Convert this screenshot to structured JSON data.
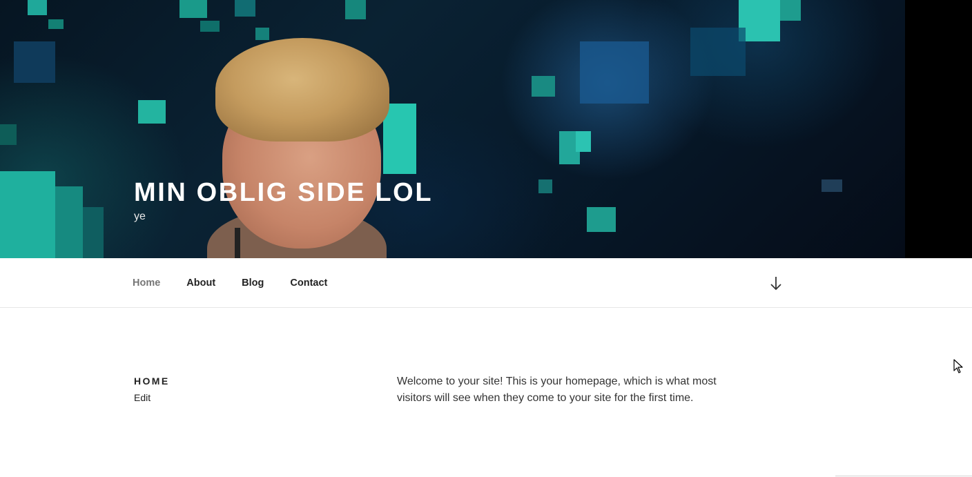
{
  "header": {
    "site_title": "MIN OBLIG SIDE LOL",
    "site_description": "ye",
    "colors": {
      "title": "#ffffff",
      "overlay": "#0a2233"
    }
  },
  "nav": {
    "items": [
      {
        "label": "Home",
        "current": true
      },
      {
        "label": "About",
        "current": false
      },
      {
        "label": "Blog",
        "current": false
      },
      {
        "label": "Contact",
        "current": false
      }
    ],
    "scroll_icon": "arrow-down-icon"
  },
  "page": {
    "title": "HOME",
    "edit_label": "Edit",
    "content": "Welcome to your site! This is your homepage, which is what most visitors will see when they come to your site for the first time."
  },
  "colors": {
    "text": "#222222",
    "nav_current": "#767676",
    "border": "#e6e6e6"
  }
}
